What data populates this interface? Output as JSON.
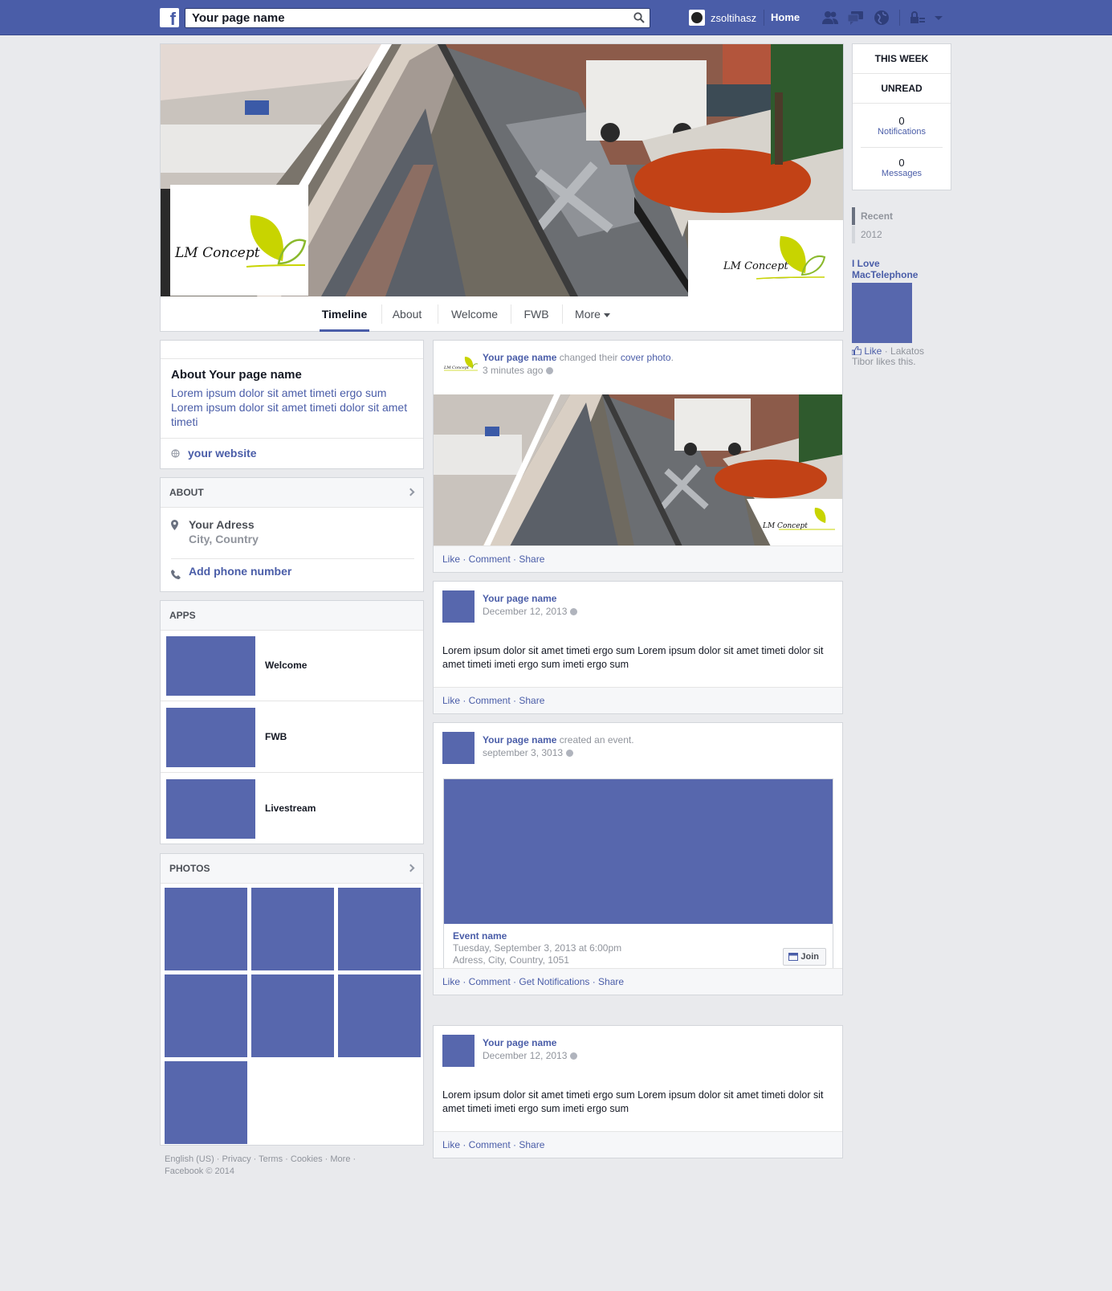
{
  "topbar": {
    "logo_letter": "f",
    "search_value": "Your page name",
    "user_name": "zsoltihasz",
    "home_label": "Home",
    "accent": "#4a5da8"
  },
  "cover": {
    "logo_text": "LM Concept",
    "logo_leaf_color": "#c8d400"
  },
  "tabs": [
    {
      "label": "Timeline"
    },
    {
      "label": "About"
    },
    {
      "label": "Welcome"
    },
    {
      "label": "FWB"
    },
    {
      "label": "More"
    }
  ],
  "about_card": {
    "title": "About Your page name",
    "description": "Lorem ipsum dolor sit amet timeti ergo sum Lorem ipsum dolor sit amet timeti dolor sit amet timeti",
    "website": "your website"
  },
  "about_section": {
    "header": "ABOUT",
    "address": "Your Adress",
    "city": "City, Country",
    "phone": "Add phone number"
  },
  "apps": {
    "header": "APPS",
    "items": [
      {
        "name": "Welcome"
      },
      {
        "name": "FWB"
      },
      {
        "name": "Livestream"
      }
    ]
  },
  "photos": {
    "header": "PHOTOS"
  },
  "footer": {
    "line1": "English (US) · Privacy · Terms · Cookies · More ·",
    "line2": "Facebook © 2014"
  },
  "posts": [
    {
      "author": "Your page name",
      "action": " changed their ",
      "action_link": "cover photo",
      "action_end": ".",
      "time": "3 minutes ago",
      "actions": "Like · Comment · Share"
    },
    {
      "author": "Your page name",
      "time": "December 12, 2013",
      "body": "Lorem ipsum dolor sit amet timeti ergo sum Lorem ipsum dolor sit amet timeti dolor sit amet timeti imeti ergo sum imeti ergo sum",
      "actions": "Like · Comment · Share"
    },
    {
      "author": "Your page name",
      "action": " created an event.",
      "time": "september 3, 3013",
      "event_name": "Event name",
      "event_date": "Tuesday, September 3, 2013 at 6:00pm",
      "event_place": "Adress, City, Country, 1051",
      "join_label": "Join",
      "actions": "Like · Comment · Get Notifications · Share"
    },
    {
      "author": "Your page name",
      "time": "December 12, 2013",
      "body": "Lorem ipsum dolor sit amet timeti ergo sum Lorem ipsum dolor sit amet timeti dolor sit amet timeti imeti ergo sum imeti ergo sum",
      "actions": "Like · Comment · Share"
    }
  ],
  "right": {
    "this_week": "THIS WEEK",
    "unread": "UNREAD",
    "notifications_count": "0",
    "notifications_label": "Notifications",
    "messages_count": "0",
    "messages_label": "Messages",
    "recent": "Recent",
    "year": "2012",
    "ad_title": "I Love MacTelephone",
    "like_label": "Like",
    "like_text": " · Lakatos Tibor likes this."
  },
  "colors": {
    "placeholder_blue": "#5767ad",
    "link_blue": "#4a5da8",
    "background": "#e9eaed"
  }
}
